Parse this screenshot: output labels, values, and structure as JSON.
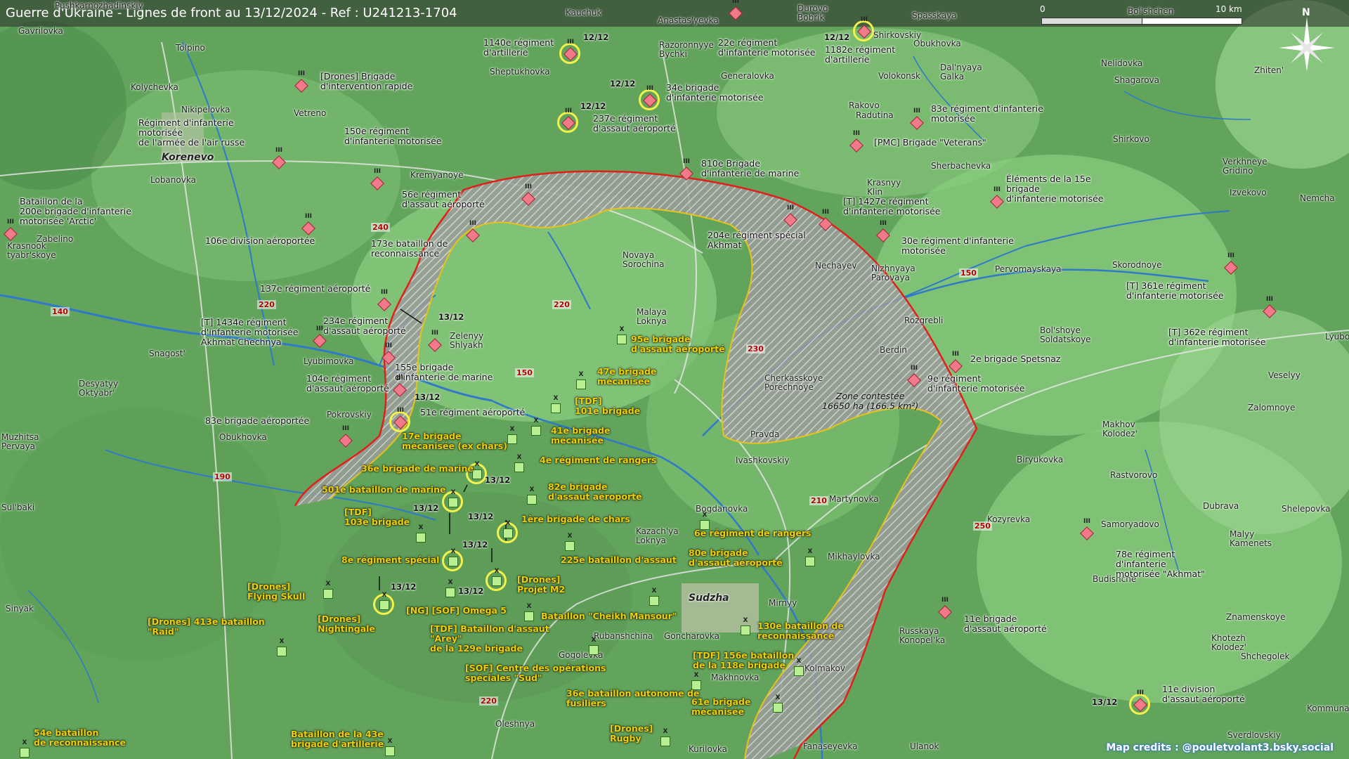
{
  "header": {
    "title": "Guerre d'Ukraine - Lignes de front au 13/12/2024 - Ref : U241213-1704"
  },
  "scale": {
    "zero": "0",
    "ten": "10 km"
  },
  "compass": {
    "north": "N"
  },
  "credits": "Map credits : @pouletvolant3.bsky.social",
  "colors": {
    "russian_unit": "#f07a8a",
    "ukrainian_unit": "#b8ef90",
    "front_line_russia": "#e0201a",
    "front_line_ukraine": "#e6c21a",
    "highlight": "#f2f24a"
  },
  "zone": {
    "label_1": "Zone contestée",
    "label_2": "16650 ha (166.5 km²)"
  },
  "towns": [
    {
      "id": "pushkar",
      "name": "Pushkarnozhadinskiy"
    },
    {
      "id": "kauchuk",
      "name": "Kauchuk"
    },
    {
      "id": "anastas",
      "name": "Anastas'yevka"
    },
    {
      "id": "durovo",
      "name": "Durovo\nBobrik"
    },
    {
      "id": "spassk",
      "name": "Spasskaya"
    },
    {
      "id": "bolshch",
      "name": "Bol'shchen"
    },
    {
      "id": "gavril",
      "name": "Gavrilovka"
    },
    {
      "id": "tolpino",
      "name": "Tolpino"
    },
    {
      "id": "shept",
      "name": "Sheptukhovka"
    },
    {
      "id": "razor",
      "name": "Razoronnyye\nBychki"
    },
    {
      "id": "shirk1",
      "name": "Shirkovskiy"
    },
    {
      "id": "obukh1",
      "name": "Obukhovka"
    },
    {
      "id": "nelid",
      "name": "Nelidovka"
    },
    {
      "id": "zhiten",
      "name": "Zhiten'"
    },
    {
      "id": "kolych",
      "name": "Kolychevka"
    },
    {
      "id": "volok",
      "name": "Volokonsk"
    },
    {
      "id": "dalnyaya",
      "name": "Dal'nyaya\nGalka"
    },
    {
      "id": "shagar",
      "name": "Shagarova"
    },
    {
      "id": "general",
      "name": "Generalovka"
    },
    {
      "id": "nikip",
      "name": "Nikipelovka"
    },
    {
      "id": "vetreno",
      "name": "Vetreno"
    },
    {
      "id": "rakovo",
      "name": "Rakovo"
    },
    {
      "id": "radutina",
      "name": "Radutina"
    },
    {
      "id": "korenevo",
      "name": "Korenevo"
    },
    {
      "id": "shirk2",
      "name": "Shirkovo"
    },
    {
      "id": "nischalny",
      "name": "Nischalnyy"
    },
    {
      "id": "lobanovka",
      "name": "Lobanovka"
    },
    {
      "id": "kremyan",
      "name": "Kremyanoye"
    },
    {
      "id": "sherbach",
      "name": "Sherbachevka"
    },
    {
      "id": "verkhn",
      "name": "Verkhneye\nGridino"
    },
    {
      "id": "krasnyy",
      "name": "Krasnyy\nKlin"
    },
    {
      "id": "izvek",
      "name": "Izvekovo"
    },
    {
      "id": "nemcha",
      "name": "Nemcha"
    },
    {
      "id": "zabelino",
      "name": "Zabelino"
    },
    {
      "id": "krasnook",
      "name": "Krasnook\ntyabr'skoye"
    },
    {
      "id": "novaya",
      "name": "Novaya\nSorochina"
    },
    {
      "id": "nechay",
      "name": "Nechayev"
    },
    {
      "id": "nizhn",
      "name": "Nizhnyaya\nParovaya"
    },
    {
      "id": "pervom",
      "name": "Pervomayskaya"
    },
    {
      "id": "skorod",
      "name": "Skorodnoye"
    },
    {
      "id": "malaya",
      "name": "Malaya\nLoknya"
    },
    {
      "id": "zeleny",
      "name": "Zelenyy\nShlyakh"
    },
    {
      "id": "rozgr",
      "name": "Rozgrebli"
    },
    {
      "id": "bolsh",
      "name": "Bol'shoye\nSoldatskoye"
    },
    {
      "id": "lyubo",
      "name": "Lyubo"
    },
    {
      "id": "snagost",
      "name": "Snagost'"
    },
    {
      "id": "lyubim",
      "name": "Lyubimovka"
    },
    {
      "id": "berdin",
      "name": "Berdin"
    },
    {
      "id": "veselyy",
      "name": "Veselyy"
    },
    {
      "id": "desyat",
      "name": "Desyatyy\nOktyabr'"
    },
    {
      "id": "cherkas",
      "name": "Cherkasskoye\nPorechnoye"
    },
    {
      "id": "zalomn",
      "name": "Zalomnoye"
    },
    {
      "id": "pokrov",
      "name": "Pokrovskiy"
    },
    {
      "id": "makhov",
      "name": "Makhov\nKolodez'"
    },
    {
      "id": "muzhitsa",
      "name": "Muzhitsa\nPervaya"
    },
    {
      "id": "obukh2",
      "name": "Obukhovka"
    },
    {
      "id": "pravda",
      "name": "Pravda"
    },
    {
      "id": "biryuk",
      "name": "Biryukovka"
    },
    {
      "id": "ivashk",
      "name": "Ivashkovskiy"
    },
    {
      "id": "rastv",
      "name": "Rastvorovo"
    },
    {
      "id": "martyn",
      "name": "Martynovka"
    },
    {
      "id": "sulbaki",
      "name": "Sul'baki"
    },
    {
      "id": "bogdan",
      "name": "Bogdanovka"
    },
    {
      "id": "kozyr",
      "name": "Kozyrevka"
    },
    {
      "id": "samoy",
      "name": "Samoryadovo"
    },
    {
      "id": "dubrava",
      "name": "Dubrava"
    },
    {
      "id": "shelep",
      "name": "Shelepovka"
    },
    {
      "id": "kazach",
      "name": "Kazach'ya\nLoknya"
    },
    {
      "id": "malyy",
      "name": "Malyy\nKamenets"
    },
    {
      "id": "mikhay",
      "name": "Mikhaylovka"
    },
    {
      "id": "sudzha",
      "name": "Sudzha"
    },
    {
      "id": "mirnyy",
      "name": "Mirnyy"
    },
    {
      "id": "budish",
      "name": "Budishche"
    },
    {
      "id": "sinyak",
      "name": "Sinyak"
    },
    {
      "id": "znamen",
      "name": "Znamenskoye"
    },
    {
      "id": "rubansh",
      "name": "Rubanshchina"
    },
    {
      "id": "gonchar",
      "name": "Goncharovka"
    },
    {
      "id": "russkaya",
      "name": "Russkaya\nKonopel'ka"
    },
    {
      "id": "khotezh",
      "name": "Khotezh\nKolodez'"
    },
    {
      "id": "gogolev",
      "name": "Gogolevka"
    },
    {
      "id": "shchegol",
      "name": "Shchegolek"
    },
    {
      "id": "kolmakov",
      "name": "Kolmakov"
    },
    {
      "id": "makhnov",
      "name": "Makhnovka"
    },
    {
      "id": "kommuna",
      "name": "Kommuna"
    },
    {
      "id": "sverdl",
      "name": "Sverdlovskiy"
    },
    {
      "id": "oleshnya",
      "name": "Oleshnya"
    },
    {
      "id": "kurilovka",
      "name": "Kurilovka"
    },
    {
      "id": "fanas",
      "name": "Fanaseyevka"
    },
    {
      "id": "ulanok",
      "name": "Ulanok"
    }
  ],
  "roads": [
    "240",
    "220",
    "140",
    "220",
    "150",
    "230",
    "150",
    "190",
    "210",
    "250",
    "220"
  ],
  "ru_units": [
    {
      "id": "r1140",
      "label": "1140e régiment\nd'artillerie"
    },
    {
      "id": "r22",
      "label": "22e régiment\nd'infanterie motorisée"
    },
    {
      "id": "r1182",
      "label": "1182e régiment\nd'artillerie"
    },
    {
      "id": "rdrones",
      "label": "[Drones] Brigade\nd'intervention rapide"
    },
    {
      "id": "r34",
      "label": "34e brigade\nd'infanterie motorisée"
    },
    {
      "id": "r83",
      "label": "83e régiment d'infanterie\nmotorisée"
    },
    {
      "id": "r237",
      "label": "237e régiment\nd'assaut aéroporté"
    },
    {
      "id": "rairforce",
      "label": "Régiment d'infanterie\nmotorisée\nde l'armée de l'air russe"
    },
    {
      "id": "r150",
      "label": "150e régiment\nd'infanterie motorisée"
    },
    {
      "id": "rpmc",
      "label": "[PMC] Brigade \"Veterans\""
    },
    {
      "id": "r810",
      "label": "810e Brigade\nd'infanterie de marine"
    },
    {
      "id": "r15",
      "label": "Éléments de la 15e\nbrigade\nd'infanterie motorisée"
    },
    {
      "id": "rarctic",
      "label": "Bataillon de la\n200e brigade d'infanterie\nmotorisée 'Arctic'"
    },
    {
      "id": "r56",
      "label": "56e régiment\nd'assaut aéroporté"
    },
    {
      "id": "r1427",
      "label": "[T] 1427e régiment\nd'infanterie motorisée"
    },
    {
      "id": "r106",
      "label": "106e division aéroportée"
    },
    {
      "id": "r204",
      "label": "204e régiment spécial\nAkhmat"
    },
    {
      "id": "r30",
      "label": "30e régiment d'infanterie\nmotorisée"
    },
    {
      "id": "r173",
      "label": "173e bataillon de\nreconnaissance"
    },
    {
      "id": "r137",
      "label": "137e régiment aéroporté"
    },
    {
      "id": "r361",
      "label": "[T] 361e régiment\nd'infanterie motorisée"
    },
    {
      "id": "r1434",
      "label": "[T] 1434e régiment\nd'infanterie motorisée\nAkhmat Chechnya"
    },
    {
      "id": "r234",
      "label": "234e régiment\nd'assaut aéroporté"
    },
    {
      "id": "r362",
      "label": "[T] 362e régiment\nd'infanterie motorisée"
    },
    {
      "id": "r155",
      "label": "155e brigade\nd'infanterie de marine"
    },
    {
      "id": "rspetsnaz",
      "label": "2e brigade Spetsnaz"
    },
    {
      "id": "r104",
      "label": "104e régiment\nd'assaut aéroporté"
    },
    {
      "id": "r9",
      "label": "9e régiment\nd'infanterie motorisée"
    },
    {
      "id": "r51",
      "label": "51e régiment aéroporté"
    },
    {
      "id": "r83b",
      "label": "83e brigade aéroportée"
    },
    {
      "id": "r78",
      "label": "78e régiment\nd'infanterie\nmotorisée \"Akhmat\""
    },
    {
      "id": "r11b",
      "label": "11e brigade\nd'assaut aéroporté"
    },
    {
      "id": "r11d",
      "label": "11e division\nd'assaut aéroporté"
    }
  ],
  "ua_units": [
    {
      "id": "u95",
      "label": "95e brigade\nd'assaut aéroporté"
    },
    {
      "id": "u47",
      "label": "47e brigade\nmécanisée"
    },
    {
      "id": "u101",
      "label": "[TDF]\n101e brigade"
    },
    {
      "id": "u41",
      "label": "41e brigade\nmécanisée"
    },
    {
      "id": "u17",
      "label": "17e brigade\nmécanisée (ex chars)"
    },
    {
      "id": "u4",
      "label": "4e régiment de rangers"
    },
    {
      "id": "u36",
      "label": "36e brigade de marine"
    },
    {
      "id": "u82",
      "label": "82e brigade\nd'assaut aéroporté"
    },
    {
      "id": "u501",
      "label": "501e bataillon de marine"
    },
    {
      "id": "u103",
      "label": "[TDF]\n103e brigade"
    },
    {
      "id": "u1chars",
      "label": "1ère brigade de chars"
    },
    {
      "id": "u6",
      "label": "6e régiment de rangers"
    },
    {
      "id": "u8",
      "label": "8e régiment spécial"
    },
    {
      "id": "u225",
      "label": "225e bataillon d'assaut"
    },
    {
      "id": "u80",
      "label": "80e brigade\nd'assaut aéroporté"
    },
    {
      "id": "uskull",
      "label": "[Drones]\nFlying Skull"
    },
    {
      "id": "um2",
      "label": "[Drones]\nProjet M2"
    },
    {
      "id": "uomega",
      "label": "[NG] [SOF] Omega 5"
    },
    {
      "id": "unight",
      "label": "[Drones]\nNightingale"
    },
    {
      "id": "umansour",
      "label": "Bataillon \"Cheikh Mansour\""
    },
    {
      "id": "uraid",
      "label": "[Drones] 413e bataillon\n\"Raid\""
    },
    {
      "id": "uarey",
      "label": "[TDF] Bataillon d'assaut\n\"Arey\"\nde la 129e brigade"
    },
    {
      "id": "u130",
      "label": "130e bataillon de\nreconnaissance"
    },
    {
      "id": "usud",
      "label": "[SOF] Centre des opérations\nspéciales \"Sud\""
    },
    {
      "id": "u156",
      "label": "[TDF] 156e bataillon\nde la 118e brigade"
    },
    {
      "id": "u36b",
      "label": "36e bataillon autonome de\nfusiliers"
    },
    {
      "id": "u61",
      "label": "61e brigade\nmécanisée"
    },
    {
      "id": "u54",
      "label": "54e bataillon\nde reconnaissance"
    },
    {
      "id": "u43",
      "label": "Bataillon de la 43e\nbrigade d'artillerie"
    },
    {
      "id": "urugby",
      "label": "[Drones]\nRugby"
    }
  ],
  "dates": [
    "12/12",
    "12/12",
    "12/12",
    "12/12",
    "13/12",
    "13/12",
    "13/12",
    "13/12",
    "13/12",
    "13/12",
    "13/12",
    "13/12",
    "13/12",
    "12/12"
  ]
}
